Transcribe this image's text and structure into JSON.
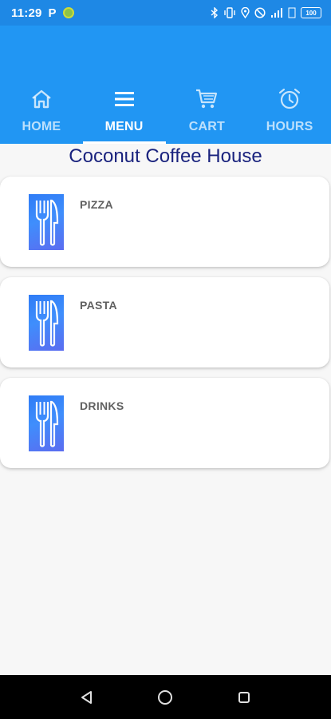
{
  "status_bar": {
    "time": "11:29",
    "notification_letter": "P",
    "battery": "100"
  },
  "tabs": [
    {
      "label": "HOME",
      "icon": "home-icon",
      "active": false
    },
    {
      "label": "MENU",
      "icon": "menu-icon",
      "active": true
    },
    {
      "label": "CART",
      "icon": "cart-icon",
      "active": false
    },
    {
      "label": "HOURS",
      "icon": "alarm-clock-icon",
      "active": false
    }
  ],
  "page": {
    "title": "Coconut Coffee House"
  },
  "menu_items": [
    {
      "label": "PIZZA",
      "icon": "fork-knife-icon"
    },
    {
      "label": "PASTA",
      "icon": "fork-knife-icon"
    },
    {
      "label": "DRINKS",
      "icon": "fork-knife-icon"
    }
  ],
  "colors": {
    "status_bar": "#1e88e5",
    "app_bar": "#2196f3",
    "title": "#1a237e",
    "item_label": "#616161",
    "background": "#f7f7f7"
  },
  "nav_bar": {
    "icons": [
      "back-icon",
      "home-circle-icon",
      "recents-icon"
    ]
  }
}
